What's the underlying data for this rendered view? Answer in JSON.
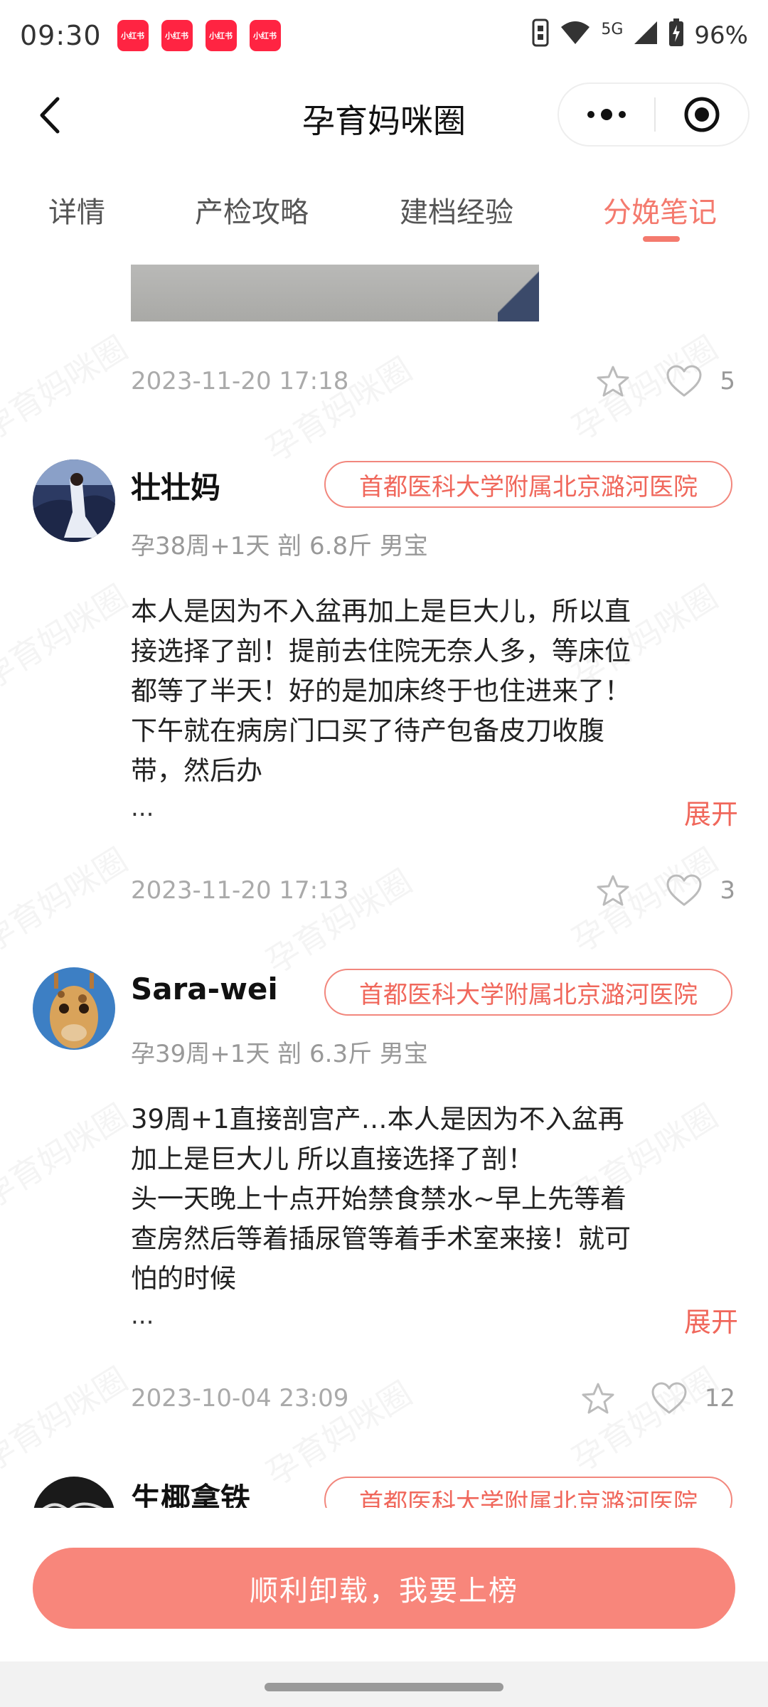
{
  "status_bar": {
    "time": "09:30",
    "notification_labels": [
      "小红书",
      "小红书",
      "小红书",
      "小红书"
    ],
    "network": "5G",
    "battery": "96%"
  },
  "header": {
    "title": "孕育妈咪圈"
  },
  "tabs": [
    {
      "label": "详情",
      "active": false
    },
    {
      "label": "产检攻略",
      "active": false
    },
    {
      "label": "建档经验",
      "active": false
    },
    {
      "label": "分娩笔记",
      "active": true
    }
  ],
  "watermark_text": "孕育妈咪圈",
  "first_post_meta": {
    "date": "2023-11-20 17:18",
    "likes": "5"
  },
  "posts": [
    {
      "username": "壮壮妈",
      "hospital": "首都医科大学附属北京潞河医院",
      "sub_info": "孕38周+1天 剖 6.8斤 男宝",
      "text_lines": [
        "本人是因为不入盆再加上是巨大儿，所以直",
        "接选择了剖！提前去住院无奈人多，等床位",
        "都等了半天！好的是加床终于也住进来了！",
        "下午就在病房门口买了待产包备皮刀收腹",
        "带，然后办"
      ],
      "ellipsis": "...",
      "expand_label": "展开",
      "date": "2023-11-20 17:13",
      "likes": "3"
    },
    {
      "username": "Sara-wei",
      "hospital": "首都医科大学附属北京潞河医院",
      "sub_info": "孕39周+1天 剖 6.3斤 男宝",
      "text_lines": [
        "39周+1直接剖宫产…本人是因为不入盆再",
        "加上是巨大儿 所以直接选择了剖！",
        "头一天晚上十点开始禁食禁水~早上先等着",
        "查房然后等着插尿管等着手术室来接！就可",
        "怕的时候"
      ],
      "ellipsis": "...",
      "expand_label": "展开",
      "date": "2023-10-04 23:09",
      "likes": "12"
    },
    {
      "username": "生椰拿铁",
      "hospital": "首都医科大学附属北京潞河医院"
    }
  ],
  "cta_label": "顺利卸载，我要上榜",
  "colors": {
    "accent": "#f47a6e",
    "cta_bg": "#f8867b",
    "tag_text": "#f0675b"
  }
}
